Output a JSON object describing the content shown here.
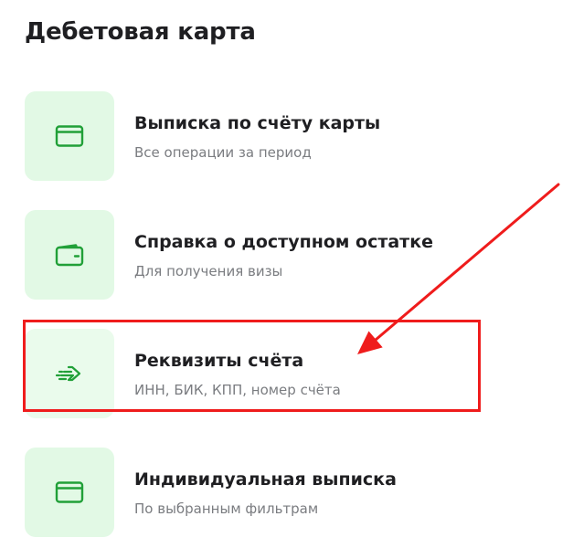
{
  "page": {
    "title": "Дебетовая карта"
  },
  "items": [
    {
      "title": "Выписка по счёту карты",
      "subtitle": "Все операции за период",
      "icon": "card-icon"
    },
    {
      "title": "Справка о доступном остатке",
      "subtitle": "Для получения визы",
      "icon": "wallet-icon"
    },
    {
      "title": "Реквизиты счёта",
      "subtitle": "ИНН, БИК, КПП, номер счёта",
      "icon": "arrow-send-icon"
    },
    {
      "title": "Индивидуальная выписка",
      "subtitle": "По выбранным фильтрам",
      "icon": "card-icon"
    }
  ],
  "colors": {
    "accent": "#21a038",
    "tile_background": "#e2f9e5",
    "annotation": "#ef1c1c",
    "subtitle_text": "#7a7c80"
  }
}
